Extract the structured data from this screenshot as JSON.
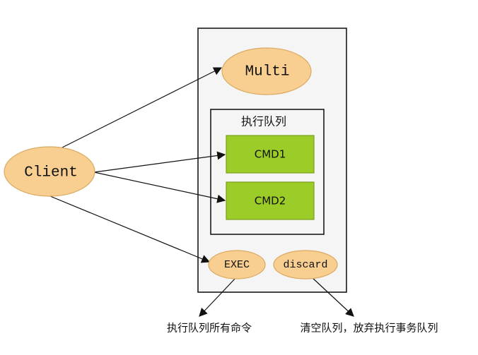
{
  "diagram": {
    "nodes": {
      "client": "Client",
      "multi": "Multi",
      "queue_title": "执行队列",
      "cmd1": "CMD1",
      "cmd2": "CMD2",
      "exec": "EXEC",
      "discard": "discard"
    },
    "notes": {
      "exec_note": "执行队列所有命令",
      "discard_note": "清空队列，放弃执行事务队列"
    }
  },
  "colors": {
    "ellipse_fill": "#f8cf90",
    "ellipse_stroke": "#d9aa62",
    "cmd_fill": "#9ccc28",
    "cmd_stroke": "#79a11a",
    "outer_box_fill": "#f5f5f5",
    "frame_stroke": "#1a1a1a"
  }
}
